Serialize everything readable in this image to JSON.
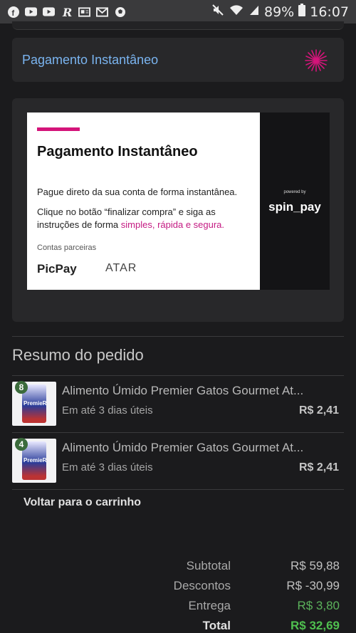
{
  "status_bar": {
    "icons": [
      "facebook-icon",
      "youtube-icon",
      "youtube-icon",
      "r-app-icon",
      "news-icon",
      "gmail-icon",
      "soccer-ball-icon"
    ],
    "battery": "89%",
    "time": "16:07"
  },
  "payment_option": {
    "title": "Pagamento Instantâneo"
  },
  "banner": {
    "title": "Pagamento Instantâneo",
    "line1": "Pague direto da sua conta de forma instantânea.",
    "line2_prefix": "Clique no botão “finalizar compra” e siga as instruções de forma ",
    "line2_highlight": "simples, rápida e segura.",
    "partners_label": "Contas parceiras",
    "partner1": "PicPay",
    "partner2": "ATAR",
    "powered_by": "powered by",
    "brand": "spin_pay",
    "accent_color": "#d4147a"
  },
  "summary": {
    "title": "Resumo do pedido",
    "items": [
      {
        "qty": "8",
        "name": "Alimento Úmido Premier Gatos Gourmet At...",
        "delivery": "Em até 3 dias úteis",
        "price": "R$ 2,41",
        "thumb_label": "PremieR"
      },
      {
        "qty": "4",
        "name": "Alimento Úmido Premier Gatos Gourmet At...",
        "delivery": "Em até 3 dias úteis",
        "price": "R$ 2,41",
        "thumb_label": "PremieR"
      }
    ],
    "back_link": "Voltar para o carrinho"
  },
  "totals": {
    "subtotal_label": "Subtotal",
    "subtotal_value": "R$ 59,88",
    "discount_label": "Descontos",
    "discount_value": "R$ -30,99",
    "shipping_label": "Entrega",
    "shipping_value": "R$ 3,80",
    "total_label": "Total",
    "total_value": "R$ 32,69"
  }
}
